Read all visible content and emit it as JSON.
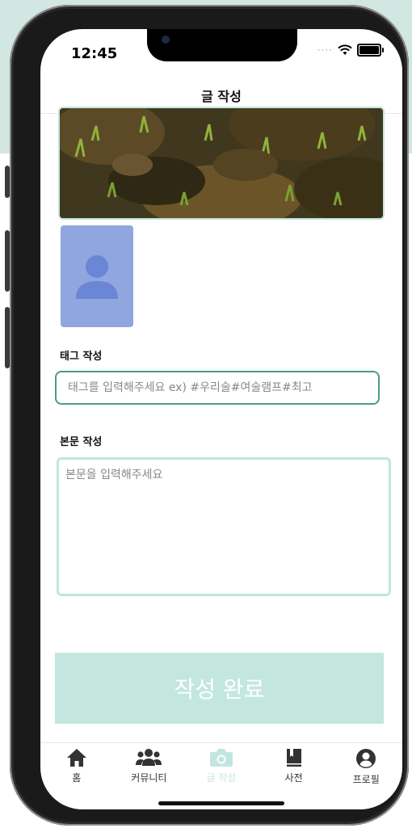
{
  "status_bar": {
    "time": "12:45"
  },
  "header": {
    "title": "글 작성"
  },
  "form": {
    "tag_label": "태그 작성",
    "tag_placeholder": "태그를 입력해주세요 ex) #우리술#여술램프#최고",
    "body_label": "본문 작성",
    "body_placeholder": "본문을 입력해주세요",
    "submit_label": "작성 완료"
  },
  "tabbar": {
    "items": [
      {
        "label": "홈",
        "icon": "home-icon"
      },
      {
        "label": "커뮤니티",
        "icon": "users-icon"
      },
      {
        "label": "글 작성",
        "icon": "camera-icon",
        "active": true
      },
      {
        "label": "사전",
        "icon": "book-icon"
      },
      {
        "label": "프로필",
        "icon": "profile-icon"
      }
    ]
  },
  "colors": {
    "accent": "#c3e7df",
    "input_border": "#4a9a8a",
    "placeholder_avatar": "#8fa6de",
    "avatar_figure": "#6a86d4",
    "background_band": "#d2e6e2"
  }
}
